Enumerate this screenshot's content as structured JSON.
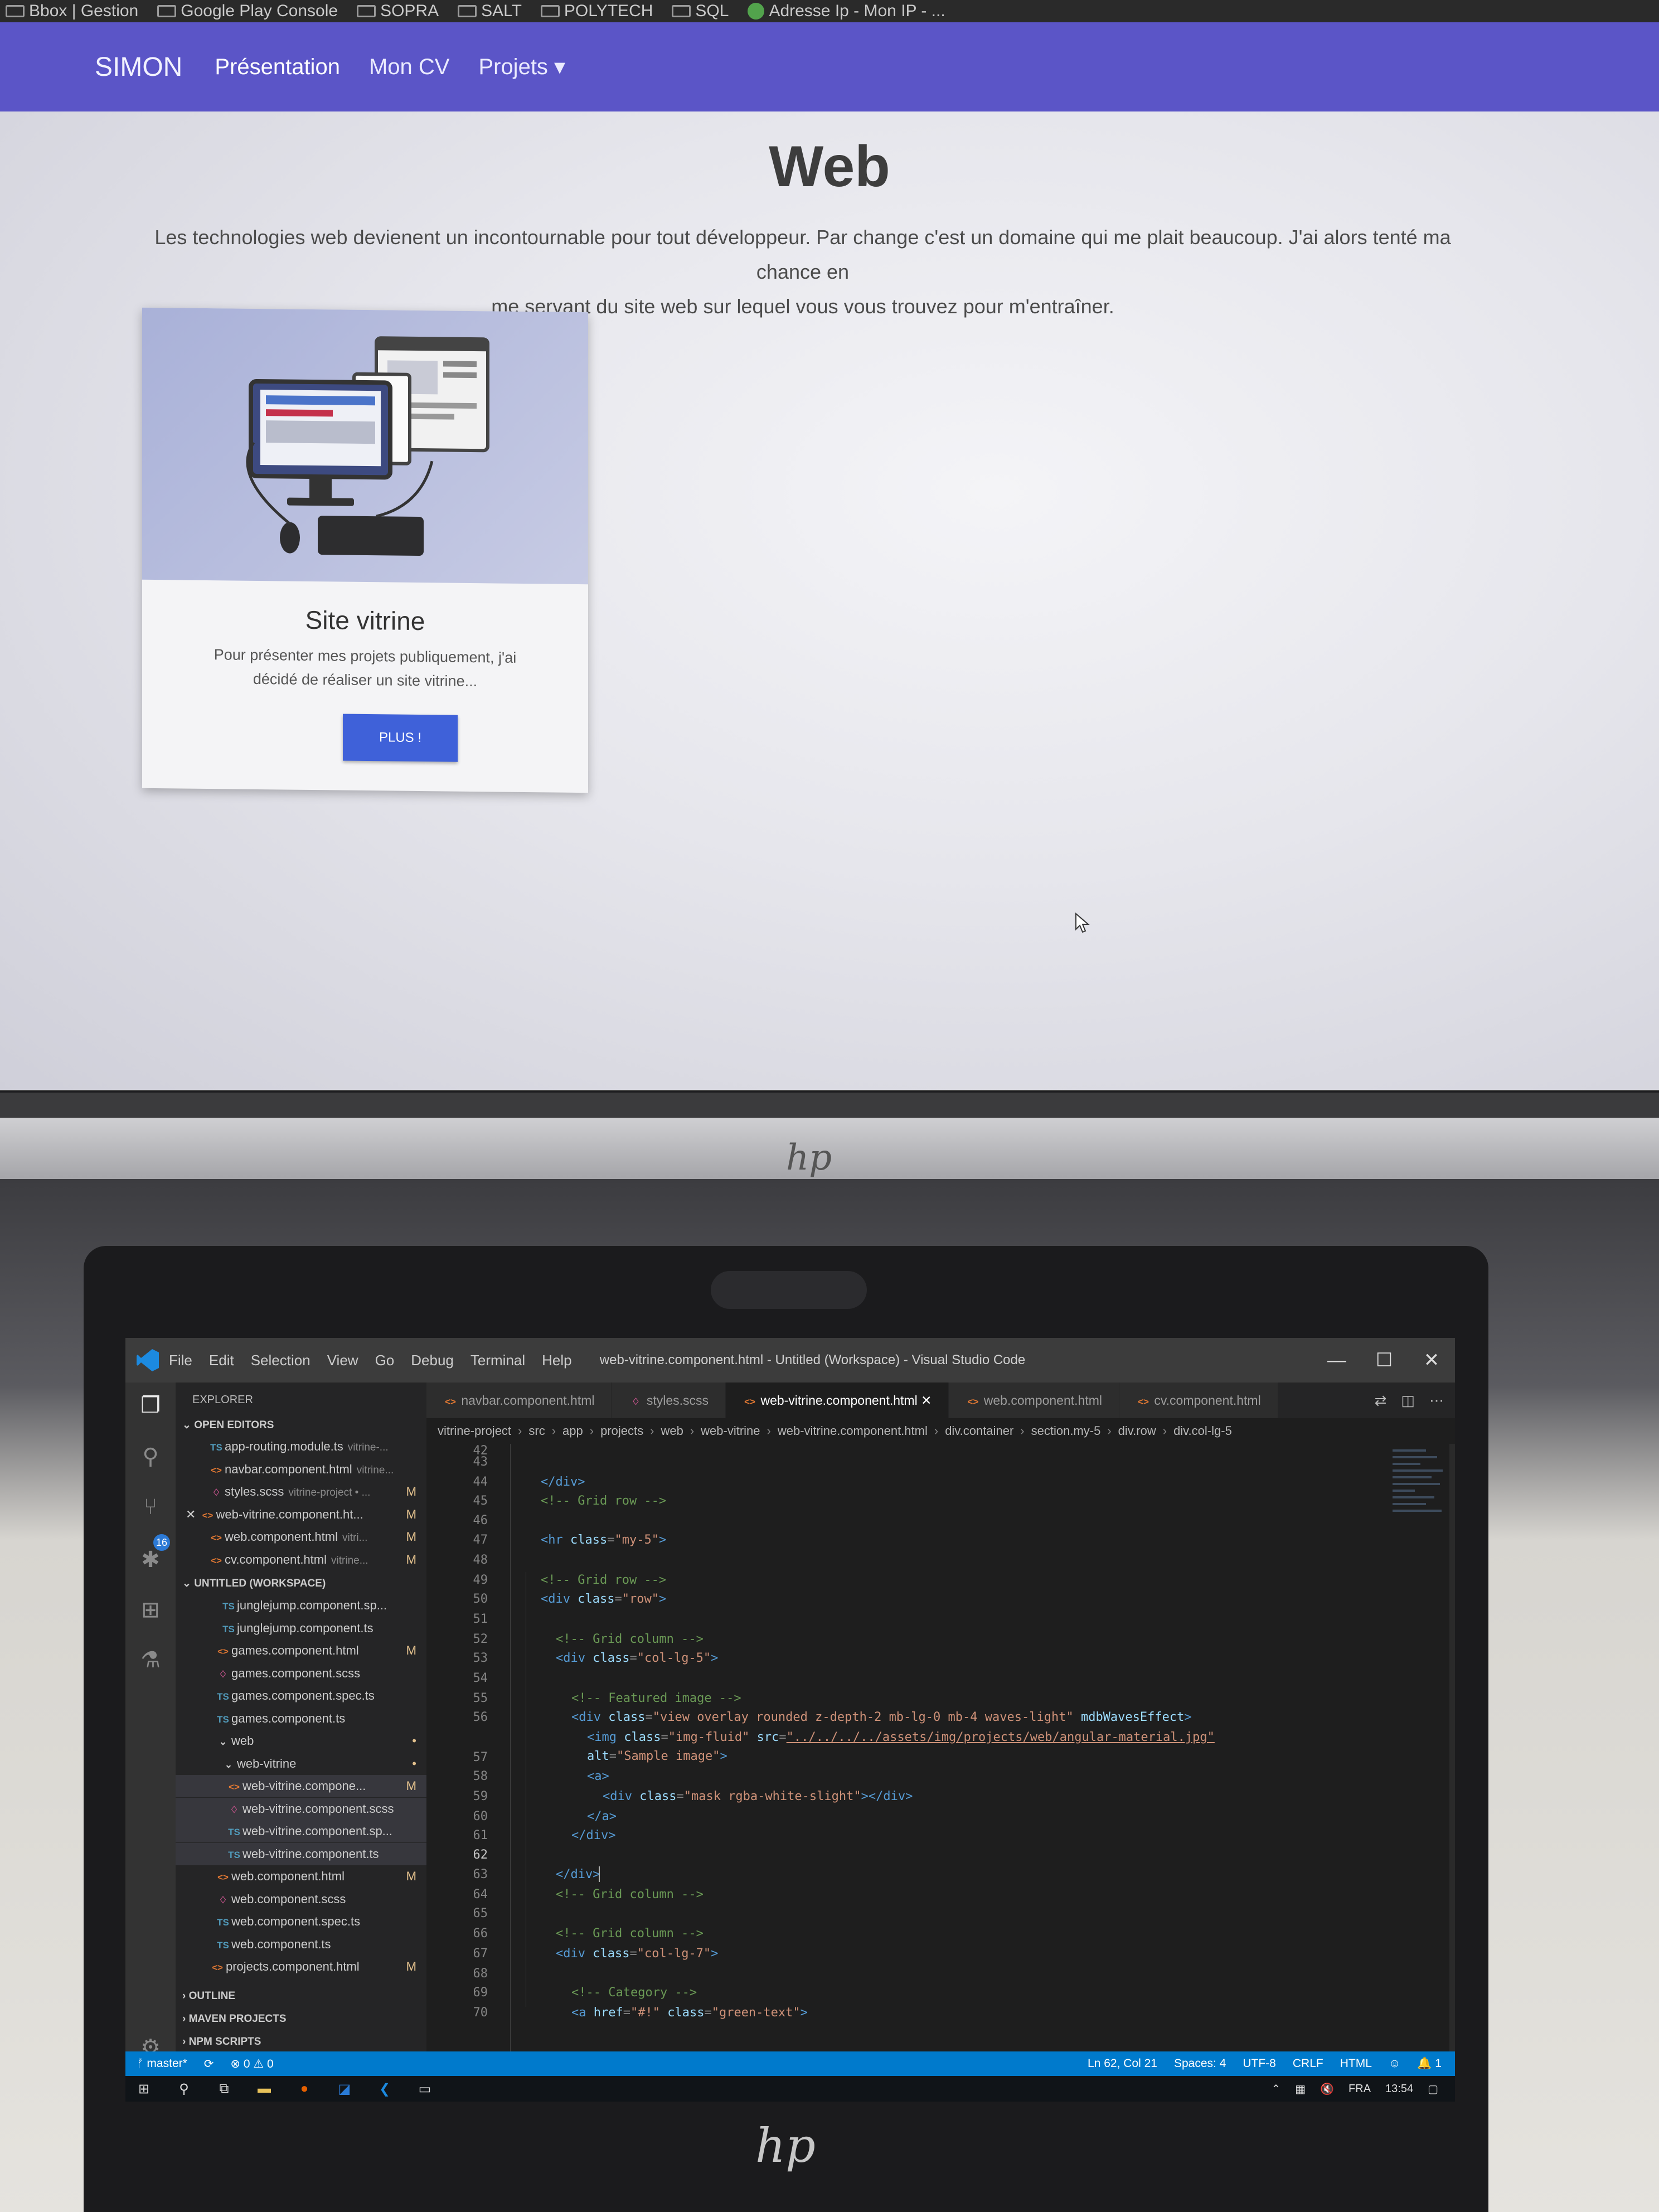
{
  "browser": {
    "bookmarks": [
      "Bbox | Gestion",
      "Google Play Console",
      "SOPRA",
      "SALT",
      "POLYTECH",
      "SQL",
      "Adresse Ip - Mon IP - ..."
    ]
  },
  "site": {
    "brand": "SIMON",
    "nav": [
      "Présentation",
      "Mon CV",
      "Projets ▾"
    ],
    "title": "Web",
    "intro_line1": "Les technologies web devienent un incontournable pour tout développeur. Par change c'est un domaine qui me plait beaucoup. J'ai alors tenté ma chance en",
    "intro_line2": "me servant du site web sur lequel vous vous trouvez pour m'entraîner.",
    "card": {
      "title": "Site vitrine",
      "text_line1": "Pour présenter mes projets publiquement, j'ai",
      "text_line2": "décidé de réaliser un site vitrine...",
      "button": "PLUS !"
    }
  },
  "monitor_brand": "hp",
  "laptop_brand": "hp",
  "vscode": {
    "menu": [
      "File",
      "Edit",
      "Selection",
      "View",
      "Go",
      "Debug",
      "Terminal",
      "Help"
    ],
    "window_title": "web-vitrine.component.html - Untitled (Workspace) - Visual Studio Code",
    "window_controls": [
      "—",
      "☐",
      "✕"
    ],
    "explorer_label": "EXPLORER",
    "source_control_badge": "16",
    "open_editors_label": "OPEN EDITORS",
    "open_editors": [
      {
        "icon": "TS",
        "kind": "ts",
        "name": "app-routing.module.ts",
        "path": "vitrine-...",
        "mod": ""
      },
      {
        "icon": "<>",
        "kind": "html",
        "name": "navbar.component.html",
        "path": "vitrine...",
        "mod": ""
      },
      {
        "icon": "♢",
        "kind": "scss",
        "name": "styles.scss",
        "path": "vitrine-project • ...",
        "mod": "M"
      },
      {
        "icon": "<>",
        "kind": "html",
        "name": "web-vitrine.component.ht...",
        "path": "",
        "mod": "M"
      },
      {
        "icon": "<>",
        "kind": "html",
        "name": "web.component.html",
        "path": "vitri...",
        "mod": "M"
      },
      {
        "icon": "<>",
        "kind": "html",
        "name": "cv.component.html",
        "path": "vitrine...",
        "mod": "M"
      }
    ],
    "workspace_label": "UNTITLED (WORKSPACE)",
    "workspace_files": [
      {
        "icon": "TS",
        "kind": "ts",
        "name": "junglejump.component.sp...",
        "mod": ""
      },
      {
        "icon": "TS",
        "kind": "ts",
        "name": "junglejump.component.ts",
        "mod": ""
      },
      {
        "icon": "<>",
        "kind": "html",
        "name": "games.component.html",
        "mod": "M"
      },
      {
        "icon": "♢",
        "kind": "scss",
        "name": "games.component.scss",
        "mod": ""
      },
      {
        "icon": "TS",
        "kind": "ts",
        "name": "games.component.spec.ts",
        "mod": ""
      },
      {
        "icon": "TS",
        "kind": "ts",
        "name": "games.component.ts",
        "mod": ""
      },
      {
        "icon": "⌄",
        "kind": "folder",
        "name": "web",
        "mod": "•"
      },
      {
        "icon": "⌄",
        "kind": "folder",
        "name": "web-vitrine",
        "mod": "•"
      },
      {
        "icon": "<>",
        "kind": "html",
        "name": "web-vitrine.compone...",
        "mod": "M"
      },
      {
        "icon": "♢",
        "kind": "scss",
        "name": "web-vitrine.component.scss",
        "mod": ""
      },
      {
        "icon": "TS",
        "kind": "ts",
        "name": "web-vitrine.component.sp...",
        "mod": ""
      },
      {
        "icon": "TS",
        "kind": "ts",
        "name": "web-vitrine.component.ts",
        "mod": ""
      },
      {
        "icon": "<>",
        "kind": "html",
        "name": "web.component.html",
        "mod": "M"
      },
      {
        "icon": "♢",
        "kind": "scss",
        "name": "web.component.scss",
        "mod": ""
      },
      {
        "icon": "TS",
        "kind": "ts",
        "name": "web.component.spec.ts",
        "mod": ""
      },
      {
        "icon": "TS",
        "kind": "ts",
        "name": "web.component.ts",
        "mod": ""
      },
      {
        "icon": "<>",
        "kind": "html",
        "name": "projects.component.html",
        "mod": "M"
      }
    ],
    "panels": [
      "OUTLINE",
      "MAVEN PROJECTS",
      "NPM SCRIPTS"
    ],
    "tabs": [
      {
        "icon": "<>",
        "kind": "html",
        "label": "navbar.component.html",
        "active": false
      },
      {
        "icon": "♢",
        "kind": "scss",
        "label": "styles.scss",
        "active": false
      },
      {
        "icon": "<>",
        "kind": "html",
        "label": "web-vitrine.component.html",
        "active": true
      },
      {
        "icon": "<>",
        "kind": "html",
        "label": "web.component.html",
        "active": false
      },
      {
        "icon": "<>",
        "kind": "html",
        "label": "cv.component.html",
        "active": false
      }
    ],
    "breadcrumbs": [
      "vitrine-project",
      "src",
      "app",
      "projects",
      "web",
      "web-vitrine",
      "web-vitrine.component.html",
      "div.container",
      "section.my-5",
      "div.row",
      "div.col-lg-5"
    ],
    "line_numbers": [
      "42",
      "43",
      "44",
      "45",
      "46",
      "47",
      "48",
      "49",
      "50",
      "51",
      "52",
      "53",
      "54",
      "55",
      "56",
      "57",
      "58",
      "59",
      "60",
      "61",
      "62",
      "63",
      "64",
      "65",
      "66",
      "67",
      "68",
      "69",
      "70"
    ],
    "current_line": "62",
    "code": {
      "l43": "</div>",
      "l44": "<!-- Grid row -->",
      "l46_tag": "<hr ",
      "l46_attr": "class",
      "l46_val": "\"my-5\"",
      "l46_end": ">",
      "l48": "<!-- Grid row -->",
      "l49_tag": "<div ",
      "l49_attr": "class",
      "l49_val": "\"row\"",
      "l49_end": ">",
      "l51": "<!-- Grid column -->",
      "l52_tag": "<div ",
      "l52_attr": "class",
      "l52_val": "\"col-lg-5\"",
      "l52_end": ">",
      "l54": "<!-- Featured image -->",
      "l55_tag": "<div ",
      "l55_attr": "class",
      "l55_val": "\"view overlay rounded z-depth-2 mb-lg-0 mb-4 waves-light\"",
      "l55_attr2": " mdbWavesEffect",
      "l55_end": ">",
      "l56_tag": "<img ",
      "l56_attr": "class",
      "l56_val": "\"img-fluid\"",
      "l56_attr2": " src",
      "l56_val2": "\"../../../../assets/img/projects/web/angular-material.jpg\"",
      "l56b_attr": "alt",
      "l56b_val": "\"Sample image\"",
      "l56b_end": ">",
      "l57": "<a>",
      "l58_tag": "<div ",
      "l58_attr": "class",
      "l58_val": "\"mask rgba-white-slight\"",
      "l58_end": "></div>",
      "l59": "</a>",
      "l60": "</div>",
      "l62": "</div>",
      "l63": "<!-- Grid column -->",
      "l65": "<!-- Grid column -->",
      "l66_tag": "<div ",
      "l66_attr": "class",
      "l66_val": "\"col-lg-7\"",
      "l66_end": ">",
      "l68": "<!-- Category -->",
      "l69_tag": "<a ",
      "l69_attr": "href",
      "l69_val": "\"#!\"",
      "l69_attr2": " class",
      "l69_val2": "\"green-text\"",
      "l69_end": ">"
    },
    "status": {
      "branch": "ᚠ master*",
      "sync": "⟳",
      "problems": "⊗ 0 ⚠ 0",
      "position": "Ln 62, Col 21",
      "spaces": "Spaces: 4",
      "encoding": "UTF-8",
      "eol": "CRLF",
      "language": "HTML",
      "notifications": "🔔 1"
    }
  },
  "taskbar": {
    "lang": "FRA",
    "time": "13:54"
  },
  "colors": {
    "nav_bg": "#5b55c7",
    "button_bg": "#3f61d9",
    "statusbar": "#007acc"
  }
}
